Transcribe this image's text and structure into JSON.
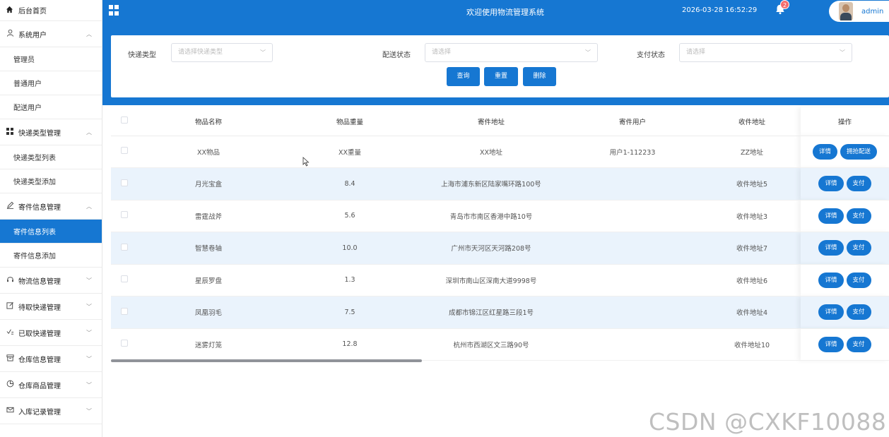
{
  "sidebar": {
    "home": "后台首页",
    "groups": [
      {
        "label": "系统用户",
        "icon": "user-icon",
        "chevron": "up",
        "items": [
          "管理员",
          "普通用户",
          "配送用户"
        ]
      },
      {
        "label": "快递类型管理",
        "icon": "grid-icon",
        "chevron": "up",
        "items": [
          "快递类型列表",
          "快递类型添加"
        ]
      },
      {
        "label": "寄件信息管理",
        "icon": "edit-icon",
        "chevron": "up",
        "items": [
          "寄件信息列表",
          "寄件信息添加"
        ],
        "active_item": "寄件信息列表"
      },
      {
        "label": "物流信息管理",
        "icon": "headset-icon",
        "chevron": "down"
      },
      {
        "label": "待取快递管理",
        "icon": "edit-square-icon",
        "chevron": "down"
      },
      {
        "label": "已取快递管理",
        "icon": "check-icon",
        "chevron": "down"
      },
      {
        "label": "仓库信息管理",
        "icon": "box-icon",
        "chevron": "down"
      },
      {
        "label": "仓库商品管理",
        "icon": "pie-icon",
        "chevron": "down"
      },
      {
        "label": "入库记录管理",
        "icon": "mail-icon",
        "chevron": "down"
      }
    ]
  },
  "header": {
    "title": "欢迎使用物流管理系统",
    "datetime": "2026-03-28 16:52:29",
    "notification_count": "2",
    "username": "admin"
  },
  "search": {
    "field1_label": "快递类型",
    "field1_placeholder": "请选择快递类型",
    "field2_label": "配送状态",
    "field2_placeholder": "请选择",
    "field3_label": "支付状态",
    "field3_placeholder": "请选择",
    "query_label": "查询",
    "reset_label": "重置",
    "delete_label": "删除"
  },
  "table": {
    "columns": [
      "物品名称",
      "物品重量",
      "寄件地址",
      "寄件用户",
      "收件地址",
      "操作"
    ],
    "rows": [
      {
        "name": "XX物品",
        "weight": "XX重量",
        "address": "XX地址",
        "user": "用户1-112233",
        "recv": "ZZ地址",
        "actions": [
          "详情",
          "拥抢配送"
        ]
      },
      {
        "name": "月光宝盒",
        "weight": "8.4",
        "address": "上海市浦东新区陆家嘴环路100号",
        "user": "",
        "recv": "收件地址5",
        "actions": [
          "详情",
          "支付"
        ]
      },
      {
        "name": "雷霆战斧",
        "weight": "5.6",
        "address": "青岛市市南区香港中路10号",
        "user": "",
        "recv": "收件地址3",
        "actions": [
          "详情",
          "支付"
        ]
      },
      {
        "name": "智慧卷轴",
        "weight": "10.0",
        "address": "广州市天河区天河路208号",
        "user": "",
        "recv": "收件地址7",
        "actions": [
          "详情",
          "支付"
        ]
      },
      {
        "name": "星辰罗盘",
        "weight": "1.3",
        "address": "深圳市南山区深南大道9998号",
        "user": "",
        "recv": "收件地址6",
        "actions": [
          "详情",
          "支付"
        ]
      },
      {
        "name": "凤凰羽毛",
        "weight": "7.5",
        "address": "成都市锦江区红星路三段1号",
        "user": "",
        "recv": "收件地址4",
        "actions": [
          "详情",
          "支付"
        ]
      },
      {
        "name": "迷雾灯笼",
        "weight": "12.8",
        "address": "杭州市西湖区文三路90号",
        "user": "",
        "recv": "收件地址10",
        "actions": [
          "详情",
          "支付"
        ]
      }
    ]
  },
  "watermark": "CSDN @CXKF10088"
}
